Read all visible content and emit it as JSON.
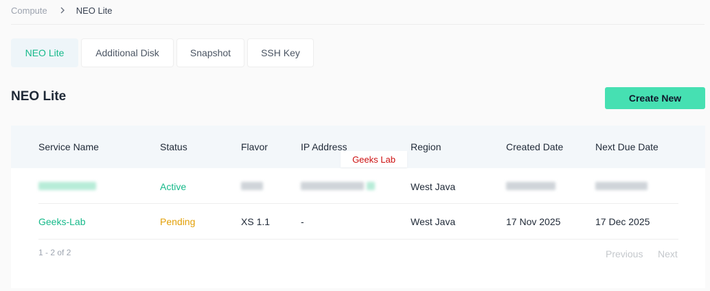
{
  "breadcrumb": {
    "parent": "Compute",
    "current": "NEO Lite"
  },
  "tabs": [
    {
      "label": "NEO Lite",
      "active": true
    },
    {
      "label": "Additional Disk",
      "active": false
    },
    {
      "label": "Snapshot",
      "active": false
    },
    {
      "label": "SSH Key",
      "active": false
    }
  ],
  "page": {
    "title": "NEO Lite",
    "create_button": "Create New"
  },
  "table": {
    "headers": [
      "Service Name",
      "Status",
      "Flavor",
      "IP Address",
      "Region",
      "Created Date",
      "Next Due Date"
    ],
    "tooltip": "Geeks Lab",
    "rows": [
      {
        "service_name": "",
        "status": "Active",
        "flavor": "",
        "ip_address": "",
        "region": "West Java",
        "created_date": "",
        "next_due_date": ""
      },
      {
        "service_name": "Geeks-Lab",
        "status": "Pending",
        "flavor": "XS 1.1",
        "ip_address": "-",
        "region": "West Java",
        "created_date": "17 Nov 2025",
        "next_due_date": "17 Dec 2025"
      }
    ]
  },
  "pagination": {
    "count": "1 - 2 of 2",
    "previous": "Previous",
    "next": "Next"
  },
  "colors": {
    "accent": "#46e0b2",
    "active_status": "#16b98a",
    "pending_status": "#e3a008",
    "tooltip_text": "#cc0f0f"
  }
}
